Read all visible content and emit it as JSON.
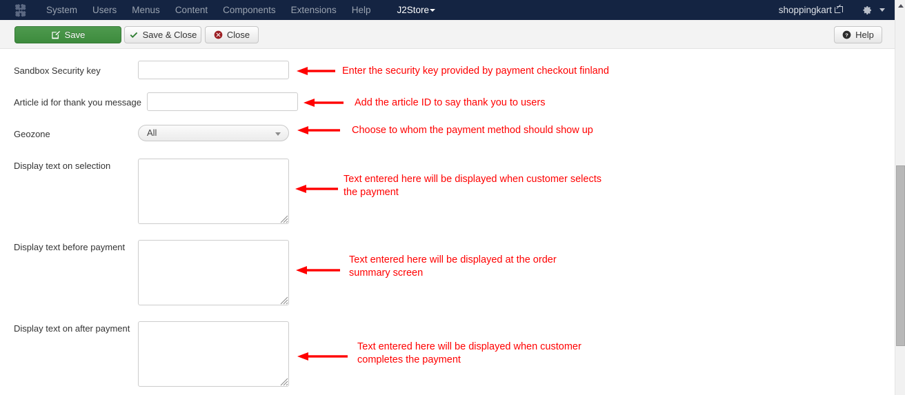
{
  "navbar": {
    "logo_icon": "joomla-logo-icon",
    "items": [
      {
        "label": "System"
      },
      {
        "label": "Users"
      },
      {
        "label": "Menus"
      },
      {
        "label": "Content"
      },
      {
        "label": "Components"
      },
      {
        "label": "Extensions"
      },
      {
        "label": "Help"
      }
    ],
    "brand": {
      "label": "J2Store",
      "caret": "chevron-down-icon"
    },
    "site_name": "shoppingkart",
    "site_name_icon": "external-link-icon",
    "gear_icon": "gear-icon",
    "gear_caret": "chevron-down-icon",
    "background_color": "#142442",
    "text_color": "#9aa3b0"
  },
  "toolbar": {
    "save_label": "Save",
    "save_icon": "pencil-square-icon",
    "save_close_label": "Save & Close",
    "save_close_icon": "check-icon",
    "close_label": "Close",
    "close_icon": "circle-x-icon",
    "help_label": "Help",
    "help_icon": "circle-question-icon",
    "save_color": "#3d8b3d",
    "background_color": "#f3f3f3"
  },
  "form": {
    "fields": [
      {
        "label": "Sandbox Security key",
        "type": "text",
        "value": "",
        "placeholder": ""
      },
      {
        "label": "Article id for thank you message",
        "type": "text",
        "value": "",
        "placeholder": ""
      },
      {
        "label": "Geozone",
        "type": "select",
        "value": "All",
        "options": [
          "All"
        ]
      },
      {
        "label": "Display text on selection",
        "type": "textarea",
        "value": "",
        "placeholder": ""
      },
      {
        "label": "Display text before payment",
        "type": "textarea",
        "value": "",
        "placeholder": ""
      },
      {
        "label": "Display text on after payment",
        "type": "textarea",
        "value": "",
        "placeholder": ""
      }
    ]
  },
  "annotations": {
    "color": "#ff0000",
    "items": [
      {
        "text": "Enter the security key provided by payment checkout finland"
      },
      {
        "text": "Add the article ID to say thank you to users"
      },
      {
        "text": "Choose to whom the payment method should show up"
      },
      {
        "text": "Text entered here will be displayed when customer selects\nthe payment"
      },
      {
        "text": "Text entered here will be displayed at the order\nsummary screen"
      },
      {
        "text": "Text entered here will be displayed when customer\ncompletes the payment"
      }
    ]
  },
  "scrollbar": {
    "up_arrow_icon": "chevron-up-icon",
    "thumb_color": "#b8b8b8",
    "track_color": "#f1f1f1"
  }
}
